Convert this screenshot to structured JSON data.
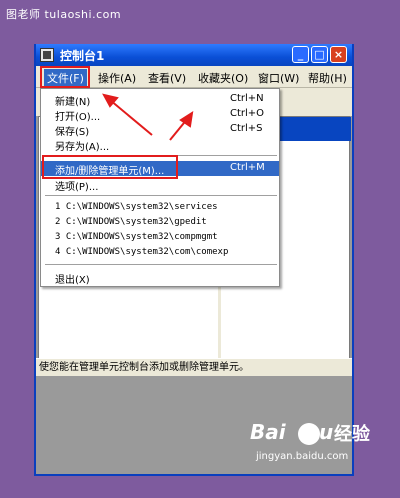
{
  "watermark": {
    "site": "图老师 tulaoshi.com",
    "baidu_text": "Bai",
    "baidu_text2": "u",
    "jingyan": "经验",
    "url": "jingyan.baidu.com"
  },
  "window": {
    "title": "控制台1",
    "controls": {
      "minimize": "_",
      "maximize": "□",
      "close": "×"
    }
  },
  "menubar": {
    "items": [
      {
        "label": "文件(F)"
      },
      {
        "label": "操作(A)"
      },
      {
        "label": "查看(V)"
      },
      {
        "label": "收藏夹(O)"
      },
      {
        "label": "窗口(W)"
      },
      {
        "label": "帮助(H)"
      }
    ]
  },
  "file_menu": {
    "items": [
      {
        "label": "新建(N)",
        "shortcut": "Ctrl+N"
      },
      {
        "label": "打开(O)...",
        "shortcut": "Ctrl+O"
      },
      {
        "label": "保存(S)",
        "shortcut": "Ctrl+S"
      },
      {
        "label": "另存为(A)...",
        "shortcut": ""
      },
      {
        "label": "添加/删除管理单元(M)...",
        "shortcut": "Ctrl+M"
      },
      {
        "label": "选项(P)...",
        "shortcut": ""
      }
    ],
    "recent": [
      {
        "label": "1 C:\\WINDOWS\\system32\\services"
      },
      {
        "label": "2 C:\\WINDOWS\\system32\\gpedit"
      },
      {
        "label": "3 C:\\WINDOWS\\system32\\compmgmt"
      },
      {
        "label": "4 C:\\WINDOWS\\system32\\com\\comexp"
      }
    ],
    "exit": {
      "label": "退出(X)"
    }
  },
  "statusbar": {
    "text": "使您能在管理单元控制台添加或删除管理单元。"
  },
  "colors": {
    "highlight": "#3169c6",
    "annotation": "#e21c1c",
    "titlebar": "#0a4fd6"
  }
}
